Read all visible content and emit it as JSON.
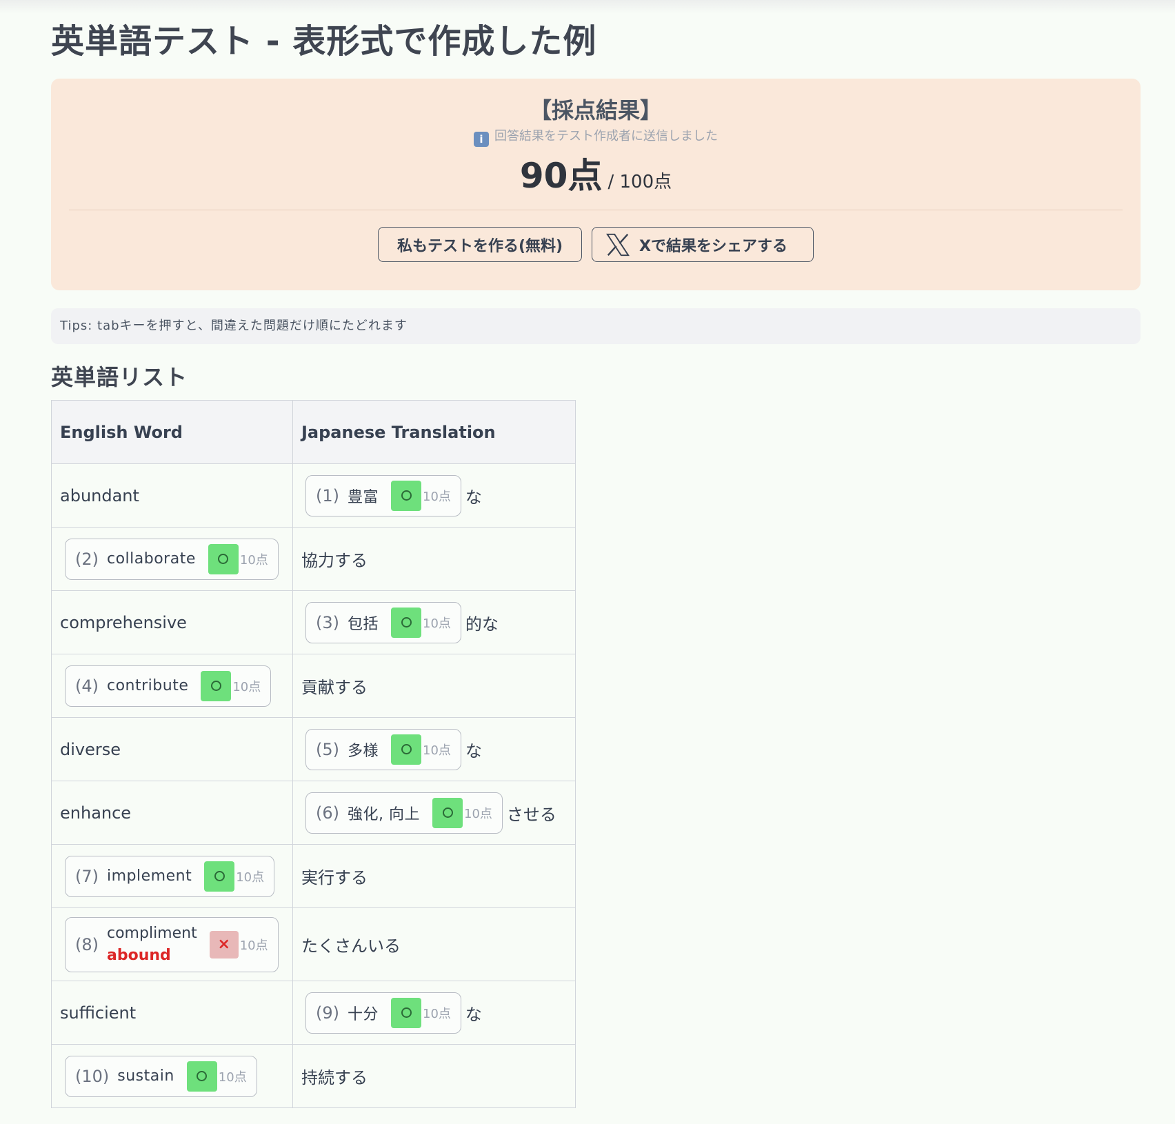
{
  "page": {
    "title": "英単語テスト - 表形式で作成した例"
  },
  "result": {
    "heading": "【採点結果】",
    "note": "回答結果をテスト作成者に送信しました",
    "score": "90点",
    "total": "/ 100点",
    "create_button": "私もテストを作る(無料)",
    "share_button": "Xで結果をシェアする"
  },
  "tips": "Tips: tabキーを押すと、間違えた問題だけ順にたどれます",
  "list": {
    "title": "英単語リスト",
    "headers": [
      "English Word",
      "Japanese Translation"
    ],
    "rows": [
      {
        "english": "abundant",
        "q": "(1)",
        "answer": "豊富",
        "mark": "○",
        "pts": "10点",
        "suffix": "な"
      },
      {
        "q": "(2)",
        "answer": "collaborate",
        "mark": "○",
        "pts": "10点",
        "japanese": "協力する"
      },
      {
        "english": "comprehensive",
        "q": "(3)",
        "answer": "包括",
        "mark": "○",
        "pts": "10点",
        "suffix": "的な"
      },
      {
        "q": "(4)",
        "answer": "contribute",
        "mark": "○",
        "pts": "10点",
        "japanese": "貢献する"
      },
      {
        "english": "diverse",
        "q": "(5)",
        "answer": "多様",
        "mark": "○",
        "pts": "10点",
        "suffix": "な"
      },
      {
        "english": "enhance",
        "q": "(6)",
        "answer": "強化, 向上",
        "mark": "○",
        "pts": "10点",
        "suffix": "させる"
      },
      {
        "q": "(7)",
        "answer": "implement",
        "mark": "○",
        "pts": "10点",
        "japanese": "実行する"
      },
      {
        "q": "(8)",
        "answer": "compliment",
        "correct": "abound",
        "mark": "×",
        "pts": "10点",
        "japanese": "たくさんいる"
      },
      {
        "english": "sufficient",
        "q": "(9)",
        "answer": "十分",
        "mark": "○",
        "pts": "10点",
        "suffix": "な"
      },
      {
        "q": "(10)",
        "answer": "sustain",
        "mark": "○",
        "pts": "10点",
        "japanese": "持続する"
      }
    ]
  },
  "colors": {
    "card_bg": "#fae8da",
    "correct_mark": "#6ee07c",
    "wrong_mark": "#e8b8b8",
    "wrong_text": "#dc2626"
  },
  "icons": {
    "info": "info-icon",
    "share": "x-logo-icon",
    "correct": "circle-icon",
    "wrong": "cross-icon"
  }
}
